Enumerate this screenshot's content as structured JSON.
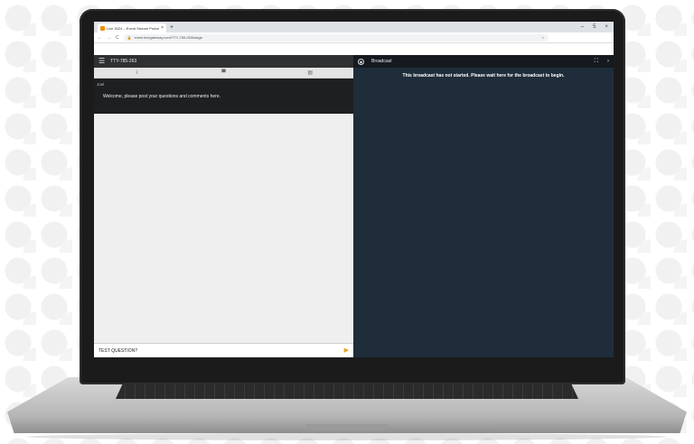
{
  "browser": {
    "tab_title": "Live 2024 – Event Stream Portal",
    "tab_close": "×",
    "new_tab": "+",
    "window_controls": {
      "minimize": "–",
      "restore": "5",
      "close": "×"
    },
    "nav": {
      "back": "←",
      "forward": "→",
      "reload": "C"
    },
    "url": "event.livegateway.com/TTY-785-263/stage",
    "star": "☆"
  },
  "chat_panel": {
    "header_title": "TTY-785-263",
    "tabs": [
      {
        "name": "info-icon",
        "glyph": "i"
      },
      {
        "name": "chat-icon",
        "glyph": "▀"
      },
      {
        "name": "document-icon",
        "glyph": "▤"
      }
    ],
    "message": {
      "author": "Joel",
      "text": "Welcome, please post your questions and comments here."
    },
    "input_value": "TEST QUESTION?",
    "send_icon": "▶"
  },
  "broadcast_panel": {
    "header_title": "Broadcast",
    "icon_glyph": "◉",
    "fullscreen_icon": "⛶",
    "collapse_icon": "›",
    "status_text": "This broadcast has not started. Please wait here for the broadcast to begin."
  },
  "colors": {
    "accent_send": "#f0a11b",
    "broadcast_bg": "#1f2d3a",
    "chat_header_bg": "#2f3031"
  }
}
